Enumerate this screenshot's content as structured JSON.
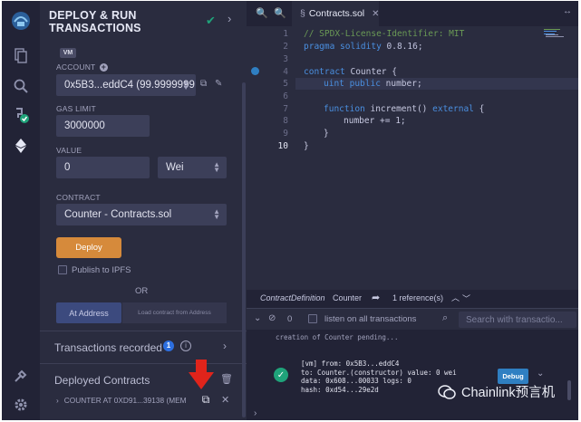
{
  "sidebar": {
    "title_line1": "DEPLOY & RUN",
    "title_line2": "TRANSACTIONS",
    "icons": [
      "remix-logo-icon",
      "file-explorer-icon",
      "search-icon",
      "solidity-compiler-icon",
      "deploy-run-icon",
      "plugin-manager-icon",
      "settings-icon"
    ]
  },
  "deploy": {
    "vm_badge": "VM",
    "account_label": "ACCOUNT",
    "account_value": "0x5B3...eddC4 (99.9999999",
    "gas_limit_label": "GAS LIMIT",
    "gas_limit_value": "3000000",
    "value_label": "VALUE",
    "value_amount": "0",
    "value_unit": "Wei",
    "contract_label": "CONTRACT",
    "contract_value": "Counter - Contracts.sol",
    "deploy_button": "Deploy",
    "publish_ipfs_label": "Publish to IPFS",
    "or_label": "OR",
    "at_address_button": "At Address",
    "load_contract_placeholder": "Load contract from Address",
    "transactions_recorded_label": "Transactions recorded",
    "transactions_recorded_count": "1",
    "deployed_contracts_label": "Deployed Contracts",
    "deployed_contract_item": "COUNTER AT 0XD91...39138 (MEM"
  },
  "editor": {
    "tab_label": "Contracts.sol",
    "line_numbers": [
      "1",
      "2",
      "3",
      "4",
      "5",
      "6",
      "7",
      "8",
      "9",
      "10"
    ],
    "code": {
      "l1": "// SPDX-License-Identifier: MIT",
      "l2_kw": "pragma solidity",
      "l2_rest": " 0.8.16;",
      "l4_kw": "contract",
      "l4_rest": " Counter {",
      "l5_kw": "uint public",
      "l5_rest": " number;",
      "l7_kw1": "function",
      "l7_mid": " increment() ",
      "l7_kw2": "external",
      "l7_rest": " {",
      "l8": "number += 1;",
      "l9": "}",
      "l10": "}"
    }
  },
  "terminal": {
    "definition_label": "ContractDefinition",
    "definition_name": "Counter",
    "references": "1 reference(s)",
    "pending_count": "0",
    "listen_label": "listen on all transactions",
    "search_placeholder": "Search with transactio...",
    "pending_message": "creation of Counter pending...",
    "tx_line1": "[vm]  from: 0x5B3...eddC4",
    "tx_line2": "to: Counter.(constructor) value: 0 wei",
    "tx_line3": "data: 0x608...00033 logs: 0",
    "tx_line4": "hash: 0xd54...29e2d",
    "debug_button": "Debug"
  },
  "watermark": {
    "text": "Chainlink预言机"
  },
  "colors": {
    "accent_green": "#1fa37a",
    "deploy_orange": "#d68a3b",
    "debug_blue": "#2f7fc2",
    "arrow_red": "#e0241b",
    "keyword_blue": "#4a8fe0",
    "comment_green": "#6a9955"
  }
}
